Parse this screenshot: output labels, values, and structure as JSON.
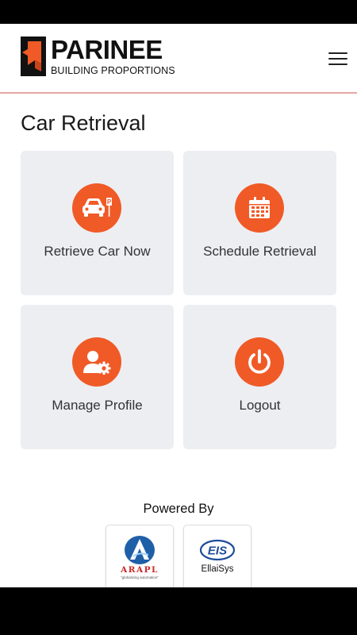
{
  "header": {
    "brand_name": "PARINEE",
    "brand_tagline": "BUILDING PROPORTIONS",
    "menu_icon": "hamburger-menu-icon"
  },
  "page": {
    "title": "Car Retrieval"
  },
  "tiles": [
    {
      "label": "Retrieve Car Now",
      "icon": "car-parking-icon"
    },
    {
      "label": "Schedule Retrieval",
      "icon": "calendar-icon"
    },
    {
      "label": "Manage Profile",
      "icon": "user-settings-icon"
    },
    {
      "label": "Logout",
      "icon": "power-icon"
    }
  ],
  "footer": {
    "powered_by": "Powered By",
    "partners": [
      {
        "name": "ARAPL",
        "tagline": "\"globalizing automation\""
      },
      {
        "name": "EllaiSys",
        "mark": "EIS"
      }
    ]
  },
  "colors": {
    "accent": "#f05a27",
    "tile_background": "#edeef2",
    "header_divider": "#e8a6a2"
  }
}
